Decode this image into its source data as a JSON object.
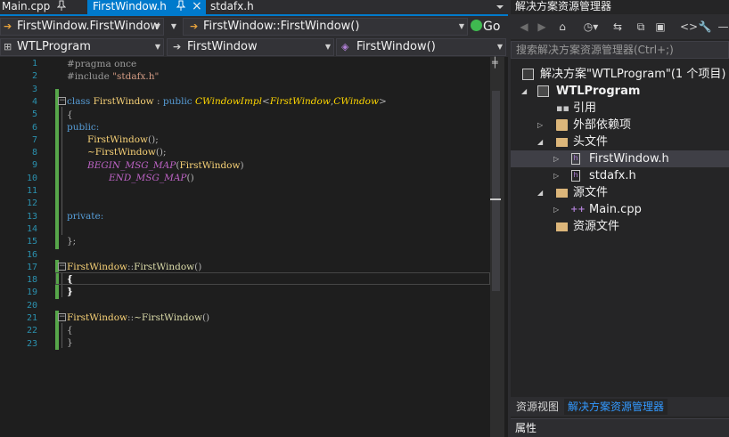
{
  "editor": {
    "tabs": [
      {
        "label": "Main.cpp",
        "pin": "pin-icon"
      },
      {
        "label": "FirstWindow.h",
        "pin": "pin-icon",
        "close": "×"
      },
      {
        "label": "stdafx.h"
      }
    ],
    "nav_top": {
      "scope": "FirstWindow.FirstWindow",
      "member": "FirstWindow::FirstWindow()",
      "go_label": "Go"
    },
    "nav_bottom": {
      "project": "WTLProgram",
      "class": "FirstWindow",
      "member": "FirstWindow()"
    },
    "line_numbers": [
      "1",
      "2",
      "3",
      "4",
      "5",
      "6",
      "7",
      "8",
      "9",
      "10",
      "11",
      "12",
      "13",
      "14",
      "15",
      "16",
      "17",
      "18",
      "19",
      "20",
      "21",
      "22",
      "23"
    ],
    "code": {
      "l1": "#pragma once",
      "l2_a": "#include ",
      "l2_b": "\"stdafx.h\"",
      "l4_a": "class ",
      "l4_b": "FirstWindow",
      "l4_c": " : ",
      "l4_d": "public ",
      "l4_e": "CWindowImpl",
      "l4_f": "<",
      "l4_g": "FirstWindow",
      "l4_h": ",",
      "l4_i": "CWindow",
      "l4_j": ">",
      "l5": "{",
      "l6": "public:",
      "l7_a": "FirstWindow",
      "l7_b": "();",
      "l8_a": "~FirstWindow",
      "l8_b": "();",
      "l9_a": "BEGIN_MSG_MAP",
      "l9_b": "(",
      "l9_c": "FirstWindow",
      "l9_d": ")",
      "l10_a": "END_MSG_MAP",
      "l10_b": "()",
      "l13": "private:",
      "l15": "};",
      "l17_a": "FirstWindow",
      "l17_b": "::",
      "l17_c": "FirstWindow",
      "l17_d": "()",
      "l18": "{",
      "l19": "}",
      "l21_a": "FirstWindow",
      "l21_b": "::",
      "l21_c": "~FirstWindow",
      "l21_d": "()",
      "l22": "{",
      "l23": "}"
    }
  },
  "solution_explorer": {
    "title": "解决方案资源管理器",
    "search_placeholder": "搜索解决方案资源管理器(Ctrl+;)",
    "tree": [
      {
        "label": "解决方案\"WTLProgram\"(1 个项目)",
        "icon": "solution-icon"
      },
      {
        "label": "WTLProgram",
        "icon": "project-icon"
      },
      {
        "label": "引用",
        "icon": "references-icon"
      },
      {
        "label": "外部依赖项",
        "icon": "external-deps-icon"
      },
      {
        "label": "头文件",
        "icon": "folder-icon"
      },
      {
        "label": "FirstWindow.h",
        "icon": "header-file-icon"
      },
      {
        "label": "stdafx.h",
        "icon": "header-file-icon"
      },
      {
        "label": "源文件",
        "icon": "folder-icon"
      },
      {
        "label": "Main.cpp",
        "icon": "cpp-file-icon"
      },
      {
        "label": "资源文件",
        "icon": "folder-icon"
      }
    ],
    "bottom_tabs": [
      "资源视图",
      "解决方案资源管理器"
    ],
    "properties_title": "属性"
  },
  "colors": {
    "accent": "#007acc",
    "background": "#1e1e1e",
    "panel": "#252526",
    "line_numbers": "#2b91af",
    "keyword": "#569cd6",
    "change_bar": "#57a64a"
  }
}
